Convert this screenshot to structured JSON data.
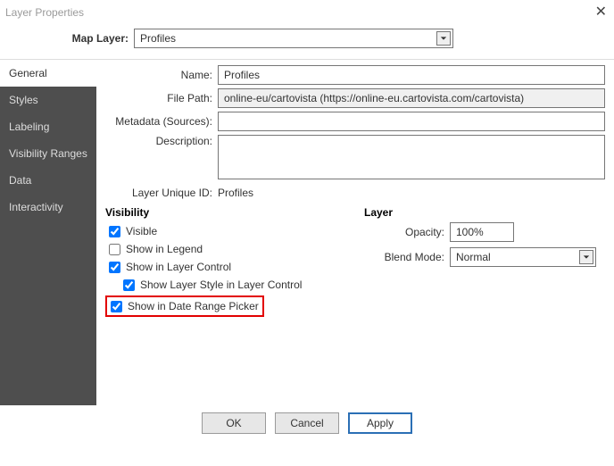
{
  "window": {
    "title": "Layer Properties"
  },
  "mapLayer": {
    "label": "Map Layer:",
    "value": "Profiles"
  },
  "sidebar": {
    "tabs": [
      {
        "label": "General"
      },
      {
        "label": "Styles"
      },
      {
        "label": "Labeling"
      },
      {
        "label": "Visibility Ranges"
      },
      {
        "label": "Data"
      },
      {
        "label": "Interactivity"
      }
    ]
  },
  "form": {
    "name_label": "Name:",
    "name_value": "Profiles",
    "filepath_label": "File Path:",
    "filepath_value": "online-eu/cartovista (https://online-eu.cartovista.com/cartovista)",
    "metadata_label": "Metadata (Sources):",
    "metadata_value": "",
    "description_label": "Description:",
    "description_value": "",
    "uid_label": "Layer Unique ID:",
    "uid_value": "Profiles"
  },
  "visibility": {
    "group_label": "Visibility",
    "items": {
      "visible": "Visible",
      "show_in_legend": "Show in Legend",
      "show_in_layer_control": "Show in Layer Control",
      "show_layer_style": "Show Layer Style in Layer Control",
      "show_in_date_range": "Show in Date Range Picker"
    }
  },
  "layer": {
    "group_label": "Layer",
    "opacity_label": "Opacity:",
    "opacity_value": "100%",
    "blend_label": "Blend Mode:",
    "blend_value": "Normal"
  },
  "buttons": {
    "ok": "OK",
    "cancel": "Cancel",
    "apply": "Apply"
  }
}
